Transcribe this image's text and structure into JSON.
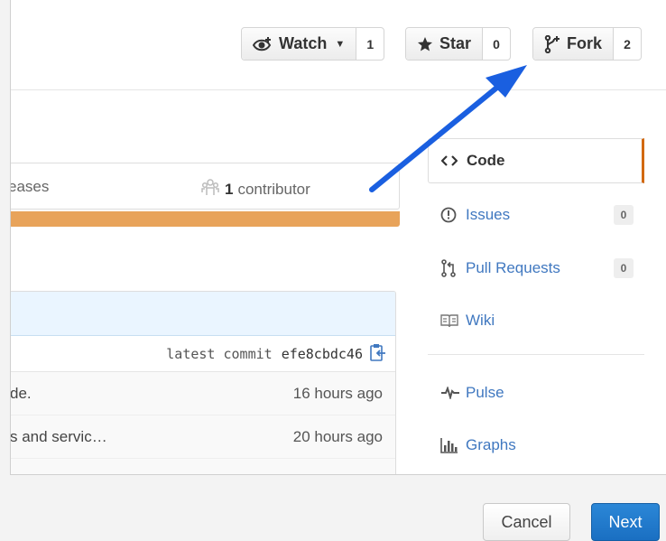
{
  "header": {
    "watch": {
      "label": "Watch",
      "count": "1"
    },
    "star": {
      "label": "Star",
      "count": "0"
    },
    "fork": {
      "label": "Fork",
      "count": "2"
    }
  },
  "summary": {
    "releases_text": "eases",
    "contributors_count": "1",
    "contributors_label": "contributor",
    "language_bar_color": "#e8a35a"
  },
  "files": {
    "latest_commit_label": "latest commit",
    "latest_commit_sha": "efe8cbdc46",
    "rows": [
      {
        "message": "de.",
        "age": "16 hours ago"
      },
      {
        "message": "s and servic…",
        "age": "20 hours ago"
      }
    ]
  },
  "repo_nav": {
    "items": [
      {
        "label": "Code",
        "icon": "code-icon",
        "selected": true
      },
      {
        "label": "Issues",
        "icon": "issue-opened-icon",
        "count": "0"
      },
      {
        "label": "Pull Requests",
        "icon": "git-pull-request-icon",
        "count": "0"
      },
      {
        "label": "Wiki",
        "icon": "book-icon"
      },
      {
        "label": "Pulse",
        "icon": "pulse-icon"
      },
      {
        "label": "Graphs",
        "icon": "graph-icon"
      }
    ],
    "selected_accent": "#d26911",
    "link_color": "#4078c0"
  },
  "annotation": {
    "arrow_color": "#1a5fe0"
  },
  "footer": {
    "cancel_label": "Cancel",
    "next_label": "Next",
    "next_color": "#2280d2"
  }
}
